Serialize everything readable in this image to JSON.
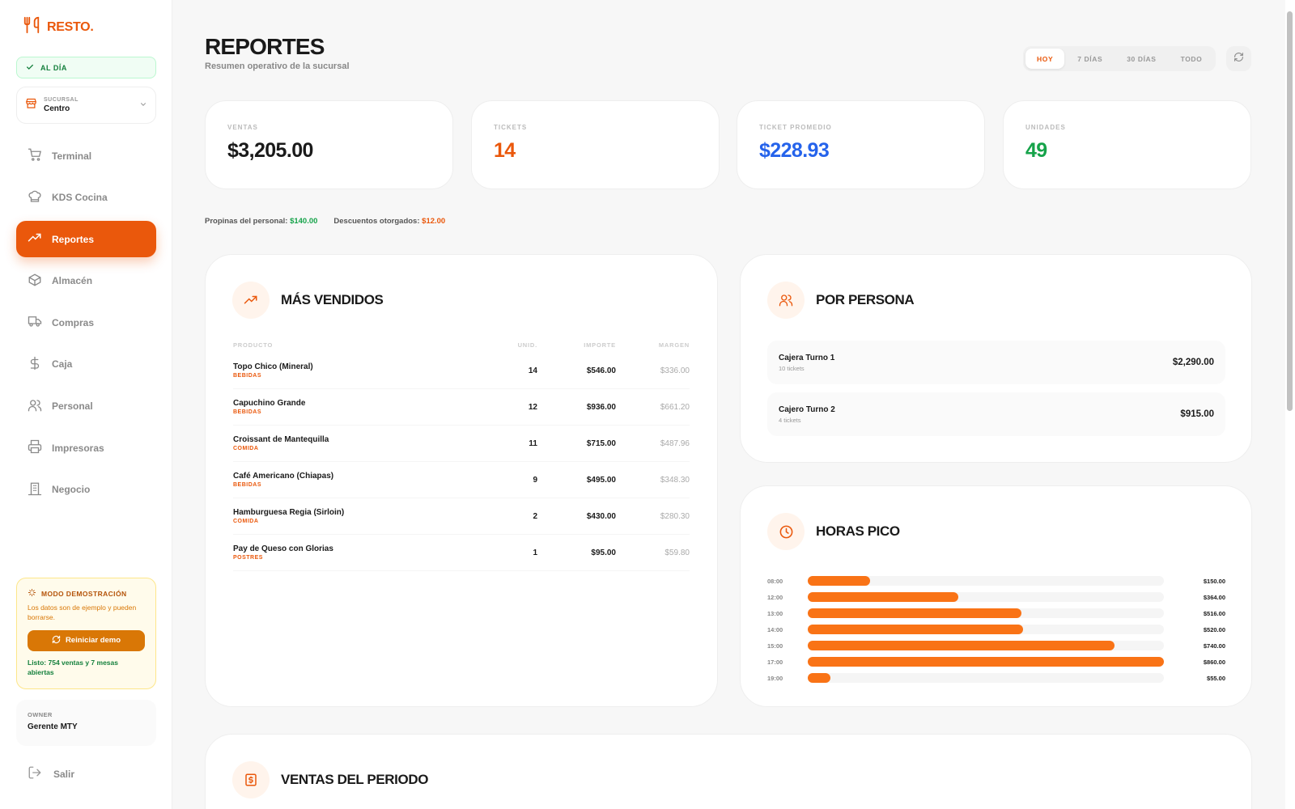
{
  "brand": {
    "name": "RESTO.",
    "accent": "#ea580c"
  },
  "status": {
    "label": "AL DÍA"
  },
  "branch": {
    "label": "SUCURSAL",
    "value": "Centro"
  },
  "nav": [
    {
      "label": "Terminal",
      "icon": "cart-icon"
    },
    {
      "label": "KDS Cocina",
      "icon": "chef-hat-icon"
    },
    {
      "label": "Reportes",
      "icon": "trending-up-icon",
      "active": true
    },
    {
      "label": "Almacén",
      "icon": "box-icon"
    },
    {
      "label": "Compras",
      "icon": "truck-icon"
    },
    {
      "label": "Caja",
      "icon": "dollar-icon"
    },
    {
      "label": "Personal",
      "icon": "users-icon"
    },
    {
      "label": "Impresoras",
      "icon": "printer-icon"
    },
    {
      "label": "Negocio",
      "icon": "building-icon"
    }
  ],
  "demo": {
    "title": "MODO DEMOSTRACIÓN",
    "description": "Los datos son de ejemplo y pueden borrarse.",
    "button": "Reiniciar demo",
    "status": "Listo: 754 ventas y 7 mesas abiertas"
  },
  "user": {
    "role": "OWNER",
    "name": "Gerente MTY"
  },
  "logout": "Salir",
  "header": {
    "title": "REPORTES",
    "subtitle": "Resumen operativo de la sucursal"
  },
  "range": {
    "options": [
      "HOY",
      "7 DÍAS",
      "30 DÍAS",
      "TODO"
    ],
    "selected": "HOY"
  },
  "kpis": [
    {
      "label": "VENTAS",
      "value": "$3,205.00",
      "color": "#1a1a1a"
    },
    {
      "label": "TICKETS",
      "value": "14",
      "color": "#ea580c"
    },
    {
      "label": "TICKET PROMEDIO",
      "value": "$228.93",
      "color": "#2563eb"
    },
    {
      "label": "UNIDADES",
      "value": "49",
      "color": "#16a34a"
    }
  ],
  "extras": {
    "tips_label": "Propinas del personal:",
    "tips_value": "$140.00",
    "discount_label": "Descuentos otorgados:",
    "discount_value": "$12.00"
  },
  "top_sellers": {
    "title": "MÁS VENDIDOS",
    "columns": [
      "PRODUCTO",
      "UNID.",
      "IMPORTE",
      "MARGEN"
    ],
    "rows": [
      {
        "name": "Topo Chico (Mineral)",
        "category": "BEBIDAS",
        "units": "14",
        "amount": "$546.00",
        "margin": "$336.00"
      },
      {
        "name": "Capuchino Grande",
        "category": "BEBIDAS",
        "units": "12",
        "amount": "$936.00",
        "margin": "$661.20"
      },
      {
        "name": "Croissant de Mantequilla",
        "category": "COMIDA",
        "units": "11",
        "amount": "$715.00",
        "margin": "$487.96"
      },
      {
        "name": "Café Americano (Chiapas)",
        "category": "BEBIDAS",
        "units": "9",
        "amount": "$495.00",
        "margin": "$348.30"
      },
      {
        "name": "Hamburguesa Regia (Sirloin)",
        "category": "COMIDA",
        "units": "2",
        "amount": "$430.00",
        "margin": "$280.30"
      },
      {
        "name": "Pay de Queso con Glorias",
        "category": "POSTRES",
        "units": "1",
        "amount": "$95.00",
        "margin": "$59.80"
      }
    ]
  },
  "by_person": {
    "title": "POR PERSONA",
    "people": [
      {
        "name": "Cajera Turno 1",
        "tickets": "10 tickets",
        "amount": "$2,290.00"
      },
      {
        "name": "Cajero Turno 2",
        "tickets": "4 tickets",
        "amount": "$915.00"
      }
    ]
  },
  "peak_hours": {
    "title": "HORAS PICO",
    "max": 860,
    "rows": [
      {
        "hour": "08:00",
        "value": 150,
        "label": "$150.00"
      },
      {
        "hour": "12:00",
        "value": 364,
        "label": "$364.00"
      },
      {
        "hour": "13:00",
        "value": 516,
        "label": "$516.00"
      },
      {
        "hour": "14:00",
        "value": 520,
        "label": "$520.00"
      },
      {
        "hour": "15:00",
        "value": 740,
        "label": "$740.00"
      },
      {
        "hour": "17:00",
        "value": 860,
        "label": "$860.00"
      },
      {
        "hour": "19:00",
        "value": 55,
        "label": "$55.00"
      }
    ]
  },
  "period_sales": {
    "title": "VENTAS DEL PERIODO"
  }
}
